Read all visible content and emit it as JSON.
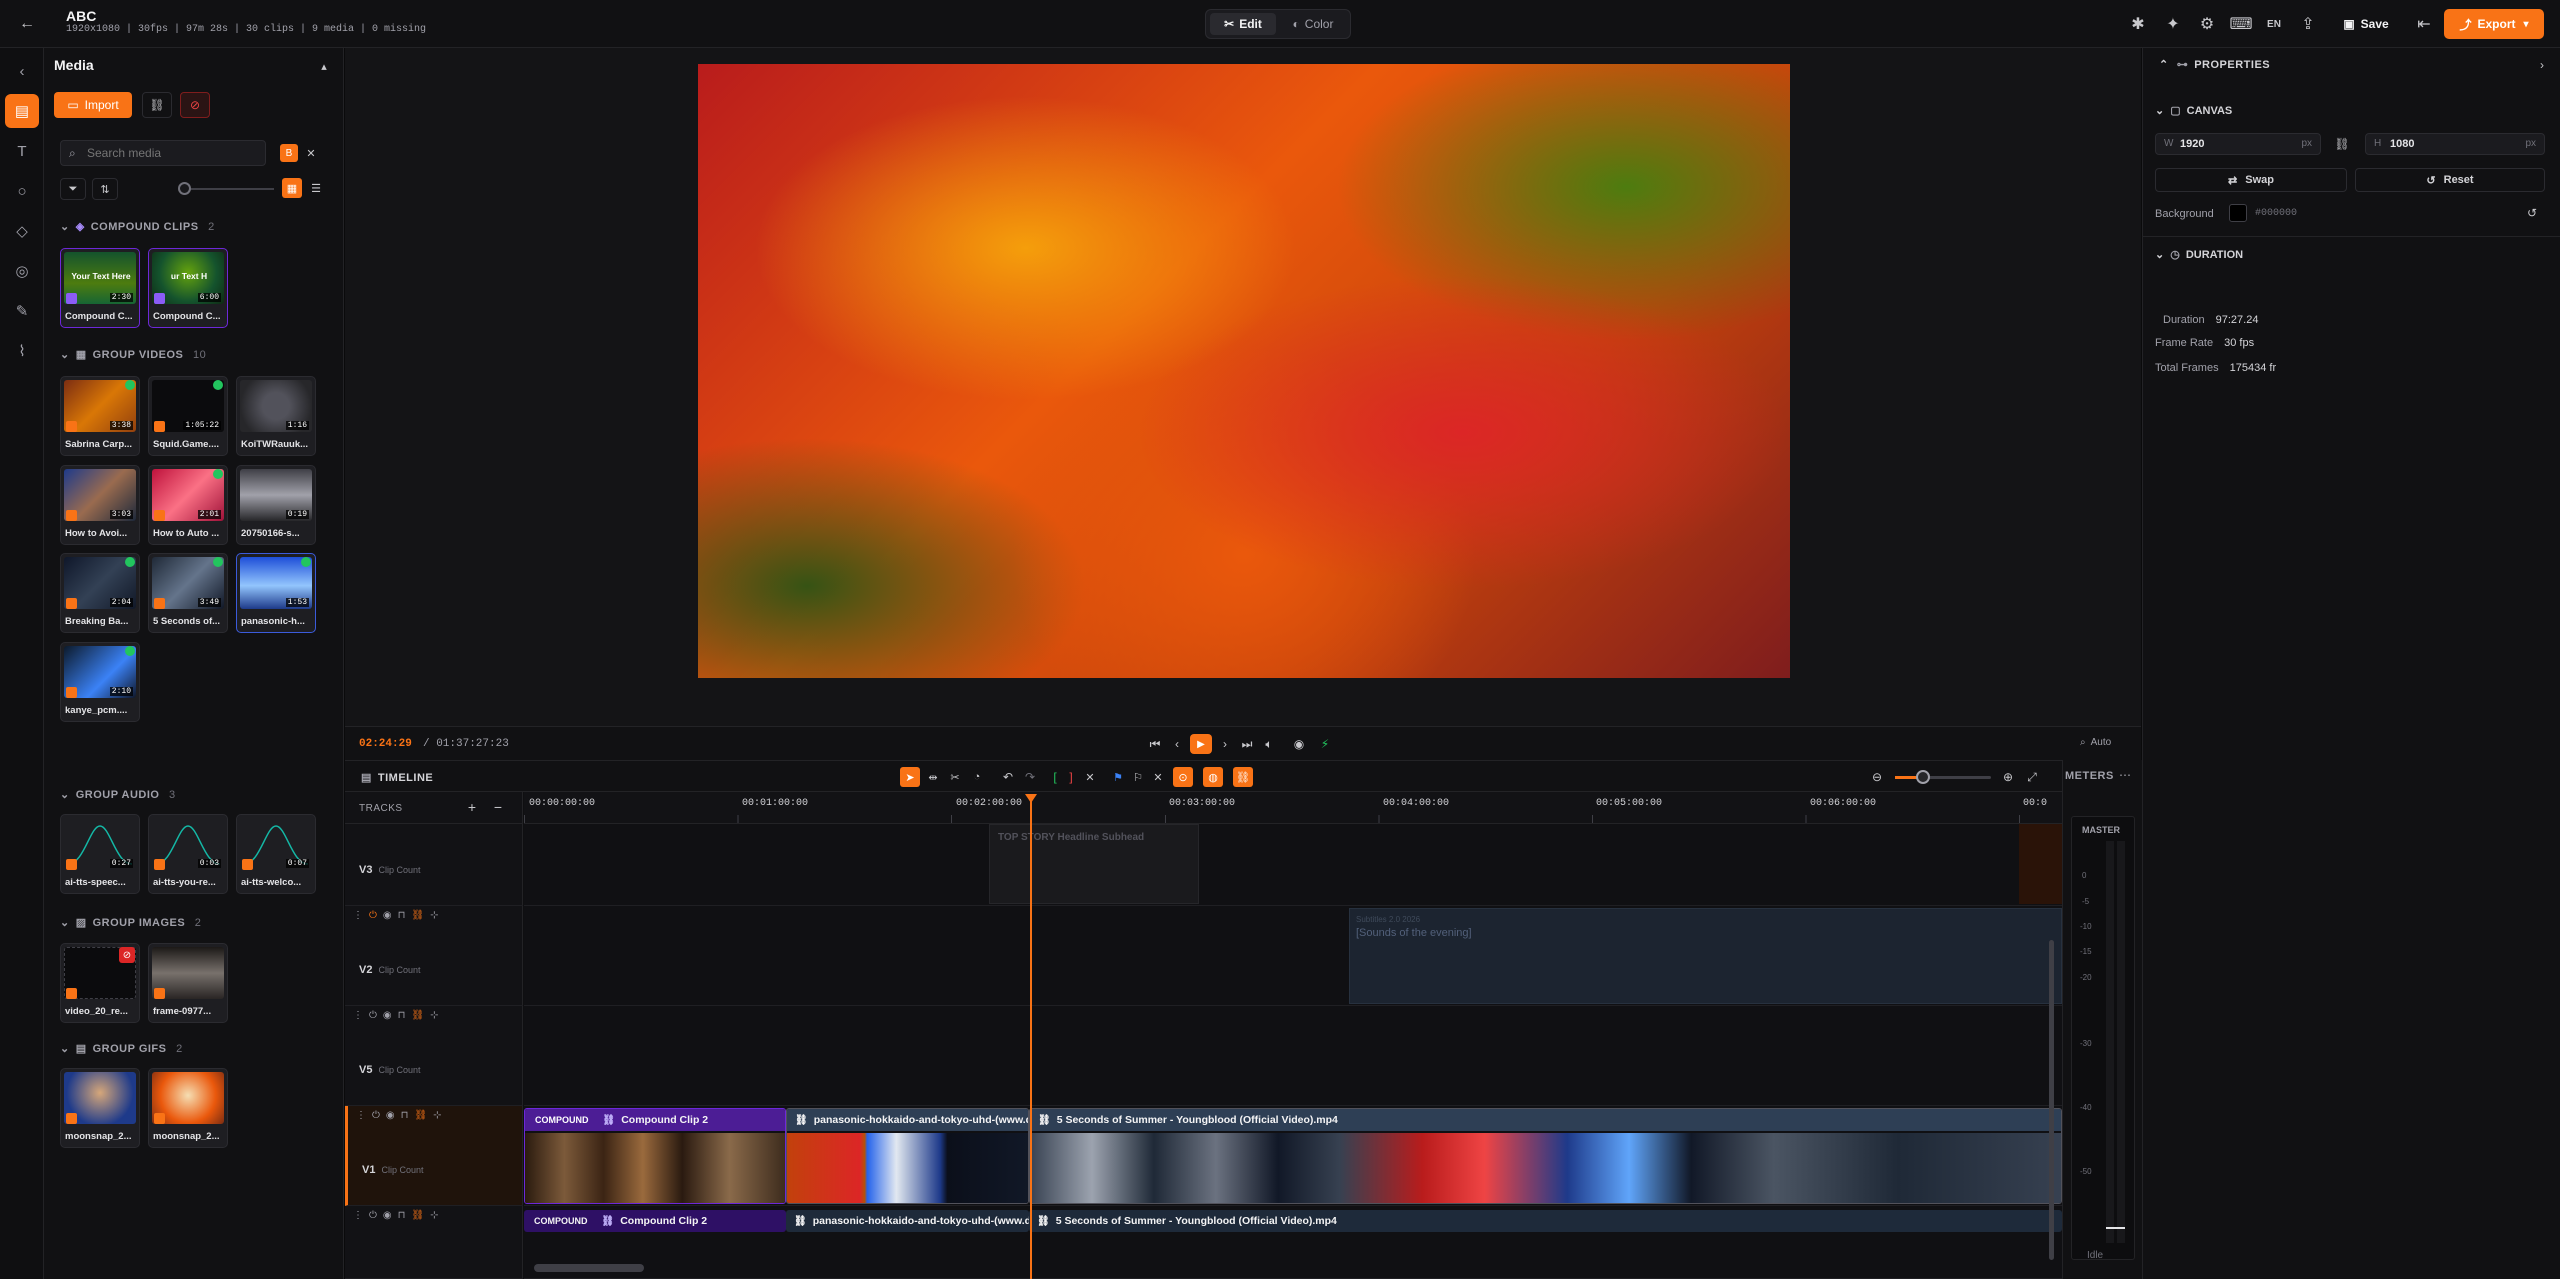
{
  "project": {
    "title": "ABC",
    "meta": "1920x1080 | 30fps | 97m 28s | 30 clips | 9 media | 0 missing"
  },
  "top_tabs": {
    "edit": "Edit",
    "color": "Color"
  },
  "top_right": {
    "lang": "EN",
    "save": "Save",
    "export": "Export"
  },
  "media_panel": {
    "title": "Media",
    "import": "Import",
    "search_placeholder": "Search media",
    "sections": [
      {
        "name": "COMPOUND CLIPS",
        "count": "2",
        "items": [
          {
            "label": "Compound C...",
            "duration": "2:30",
            "overlay": "Your Text Here"
          },
          {
            "label": "Compound C...",
            "duration": "6:00",
            "overlay": "ur Text H"
          }
        ]
      },
      {
        "name": "GROUP VIDEOS",
        "count": "10",
        "items": [
          {
            "label": "Sabrina Carp...",
            "duration": "3:38"
          },
          {
            "label": "Squid.Game....",
            "duration": "1:05:22"
          },
          {
            "label": "KoiTWRauuk...",
            "duration": "1:16"
          },
          {
            "label": "How to Avoi...",
            "duration": "3:03"
          },
          {
            "label": "How to Auto ...",
            "duration": "2:01"
          },
          {
            "label": "20750166-s...",
            "duration": "0:19"
          },
          {
            "label": "Breaking Ba...",
            "duration": "2:04"
          },
          {
            "label": "5 Seconds of...",
            "duration": "3:49"
          },
          {
            "label": "panasonic-h...",
            "duration": "1:53"
          },
          {
            "label": "kanye_pcm....",
            "duration": "2:10"
          }
        ]
      },
      {
        "name": "GROUP AUDIO",
        "count": "3",
        "items": [
          {
            "label": "ai-tts-speec...",
            "duration": "0:27"
          },
          {
            "label": "ai-tts-you-re...",
            "duration": "0:03"
          },
          {
            "label": "ai-tts-welco...",
            "duration": "0:07"
          }
        ]
      },
      {
        "name": "GROUP IMAGES",
        "count": "2",
        "items": [
          {
            "label": "video_20_re..."
          },
          {
            "label": "frame-0977..."
          }
        ]
      },
      {
        "name": "GROUP GIFS",
        "count": "2",
        "items": [
          {
            "label": "moonsnap_2..."
          },
          {
            "label": "moonsnap_2..."
          }
        ]
      }
    ]
  },
  "transport": {
    "current": "02:24:29",
    "total": "/ 01:37:27:23",
    "zoom": "Auto"
  },
  "properties": {
    "title": "PROPERTIES",
    "canvas": {
      "title": "CANVAS",
      "w_label": "W",
      "w": "1920",
      "h_label": "H",
      "h": "1080",
      "unit": "px",
      "swap": "Swap",
      "reset": "Reset",
      "bg_label": "Background",
      "bg_value": "#000000"
    },
    "duration": {
      "title": "DURATION",
      "duration_label": "Duration",
      "duration": "97:27.24",
      "fps_label": "Frame Rate",
      "fps": "30 fps",
      "frames_label": "Total Frames",
      "frames": "175434 fr"
    }
  },
  "timeline": {
    "title": "TIMELINE",
    "tracks_label": "TRACKS",
    "ruler": [
      "00:00:00:00",
      "00:01:00:00",
      "00:02:00:00",
      "00:03:00:00",
      "00:04:00:00",
      "00:05:00:00",
      "00:06:00:00",
      "00:0"
    ],
    "tracks": [
      {
        "name": "V3",
        "sub": "Clip Count"
      },
      {
        "name": "V2",
        "sub": "Clip Count"
      },
      {
        "name": "V5",
        "sub": "Clip Count"
      },
      {
        "name": "V1",
        "sub": "Clip Count"
      }
    ],
    "v3_clip": "TOP STORY Headline Subhead",
    "v2_clip": "[Sounds of the evening]",
    "v2_clip_small": "Subtitles 2.0 2026",
    "v1_clips": [
      {
        "badge": "COMPOUND",
        "name": "Compound Clip 2"
      },
      {
        "name": "panasonic-hokkaido-and-tokyo-uhd-(www.demolandia.net).mkv"
      },
      {
        "name": "5 Seconds of Summer - Youngblood (Official Video).mp4"
      }
    ]
  },
  "meters": {
    "title": "METERS",
    "master": "MASTER",
    "scale": [
      "0",
      "-5",
      "-10",
      "-15",
      "-20",
      "-30",
      "-40",
      "-50"
    ],
    "status": "Idle"
  },
  "colors": {
    "accent": "#f97316",
    "compound": "#4c1d95",
    "clipbar": "#2e3f55"
  }
}
